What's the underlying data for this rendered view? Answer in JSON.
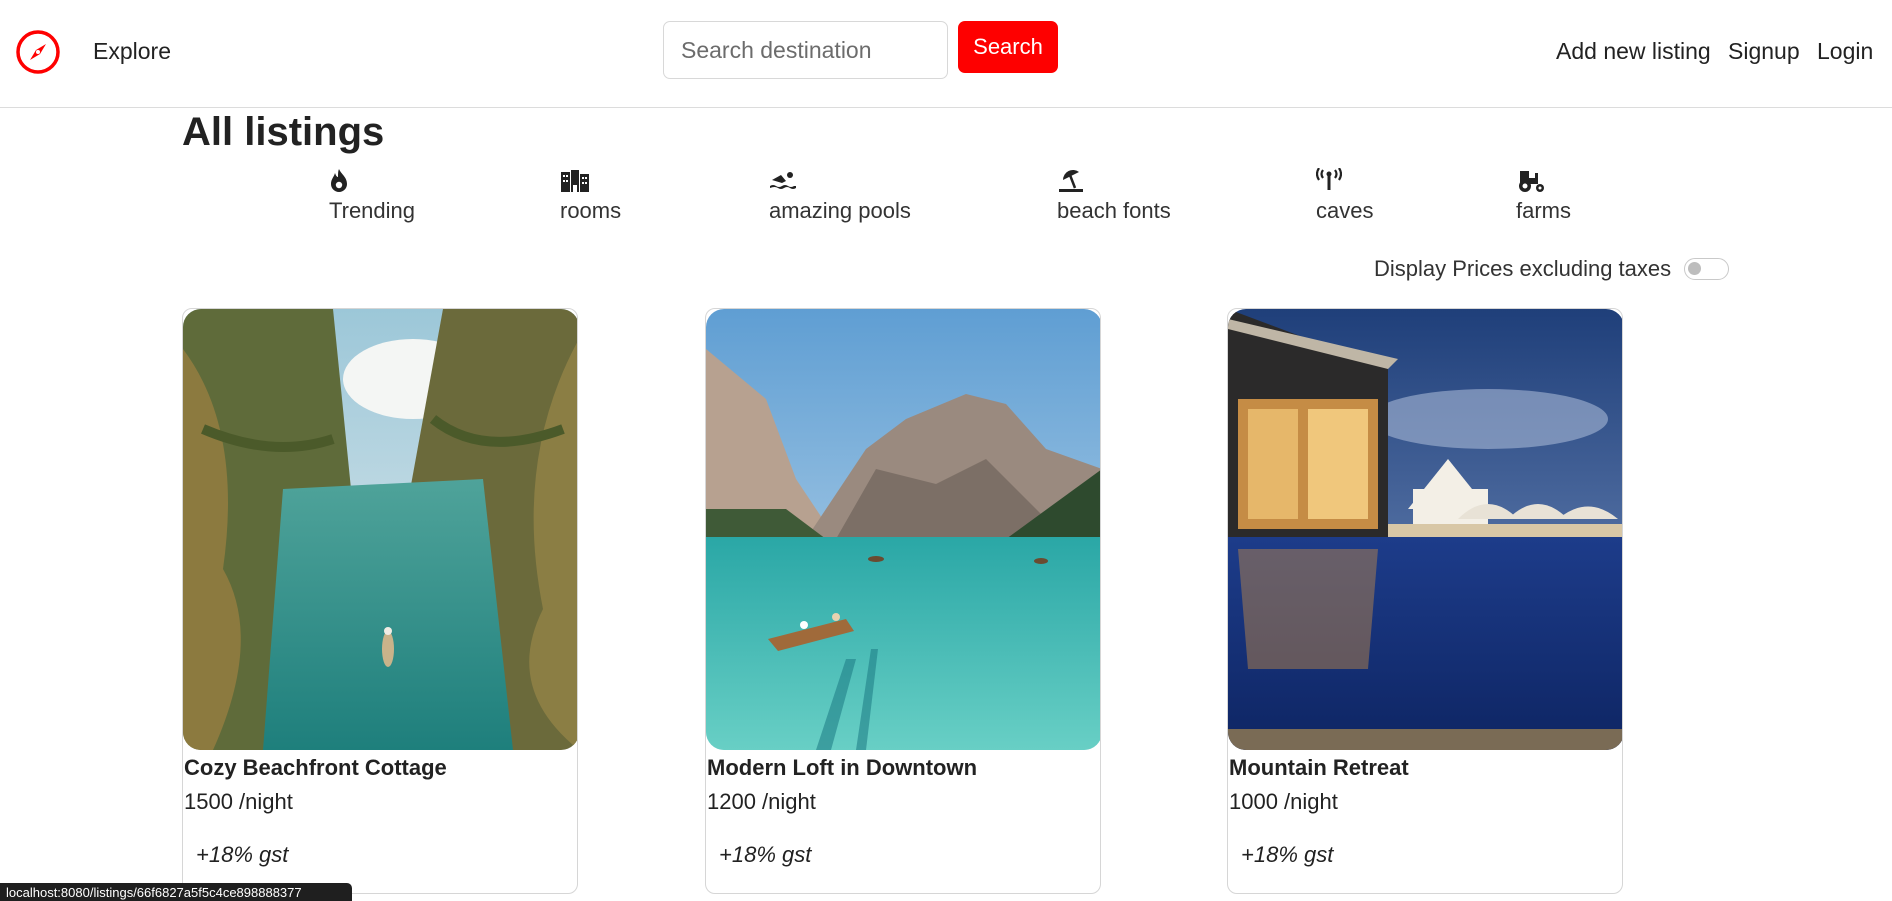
{
  "navbar": {
    "brand_icon": "compass-icon",
    "explore": "Explore",
    "search": {
      "placeholder": "Search destination",
      "button": "Search"
    },
    "links": [
      "Add new listing",
      "Signup",
      "Login"
    ],
    "accent_color": "#fe0000"
  },
  "page": {
    "title": "All listings"
  },
  "filters": [
    {
      "label": "Trending",
      "icon": "fire-icon"
    },
    {
      "label": "rooms",
      "icon": "buildings-icon"
    },
    {
      "label": "amazing pools",
      "icon": "swimmer-icon"
    },
    {
      "label": "beach fonts",
      "icon": "umbrella-beach-icon"
    },
    {
      "label": "caves",
      "icon": "tower-broadcast-icon"
    },
    {
      "label": "farms",
      "icon": "tractor-icon"
    }
  ],
  "tax_toggle": {
    "label": "Display Prices excluding taxes",
    "checked": false
  },
  "listings": [
    {
      "title": "Cozy Beachfront Cottage",
      "price": "1500 /night",
      "tax": "+18% gst"
    },
    {
      "title": "Modern Loft in Downtown",
      "price": "1200 /night",
      "tax": "+18% gst"
    },
    {
      "title": "Mountain Retreat",
      "price": "1000 /night",
      "tax": "+18% gst"
    }
  ],
  "status_bar": {
    "url": "localhost:8080/listings/66f6827a5f5c4ce898888377"
  }
}
